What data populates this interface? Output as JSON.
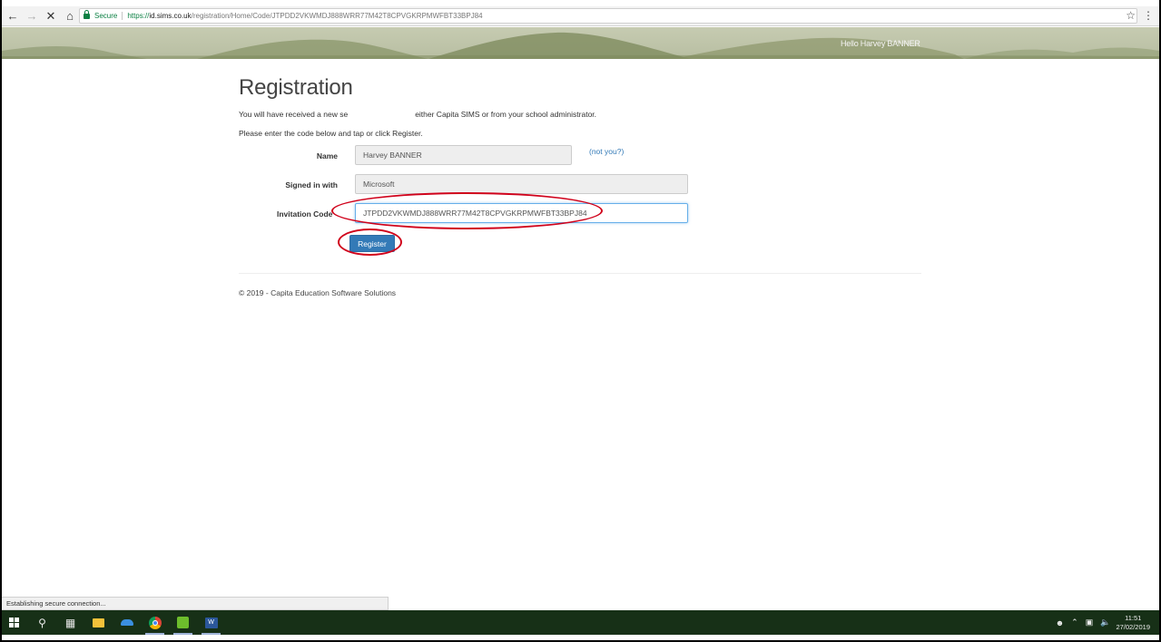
{
  "browser": {
    "back_icon": "back-arrow-icon",
    "forward_icon": "forward-arrow-icon",
    "stop_icon": "close-icon",
    "home_icon": "home-icon",
    "secure_label": "Secure",
    "url_scheme": "https://",
    "url_host": "id.sims.co.uk",
    "url_path": "/registration/Home/Code/JTPDD2VKWMDJ888WRR77M42T8CPVGKRPMWFBT33BPJ84",
    "bookmark_icon": "star-icon",
    "menu_icon": "kebab-menu-icon"
  },
  "header": {
    "greeting": "Hello Harvey BANNER"
  },
  "main": {
    "title": "Registration",
    "intro_line1_start": "You will have received a new se",
    "intro_line1_end": "either Capita SIMS or from your school administrator.",
    "intro_line2": "Please enter the code below and tap or click Register.",
    "form": {
      "name_label": "Name",
      "name_value": "Harvey BANNER",
      "not_you_link": "(not you?)",
      "signed_in_label": "Signed in with",
      "signed_in_value": "Microsoft",
      "invitation_label": "Invitation Code",
      "invitation_value": "JTPDD2VKWMDJ888WRR77M42T8CPVGKRPMWFBT33BPJ84",
      "register_button": "Register"
    },
    "footer": "© 2019 - Capita Education Software Solutions"
  },
  "status_bar": {
    "text": "Establishing secure connection..."
  },
  "taskbar": {
    "icons": [
      "windows-start-icon",
      "search-icon",
      "task-view-icon",
      "file-explorer-icon",
      "onedrive-icon",
      "chrome-icon",
      "green-app-icon",
      "word-icon"
    ],
    "time": "11:51",
    "date": "27/02/2019"
  },
  "colors": {
    "accent": "#337ab7",
    "annotation": "#d0021b",
    "secure_green": "#0b8043",
    "taskbar": "#173017"
  }
}
